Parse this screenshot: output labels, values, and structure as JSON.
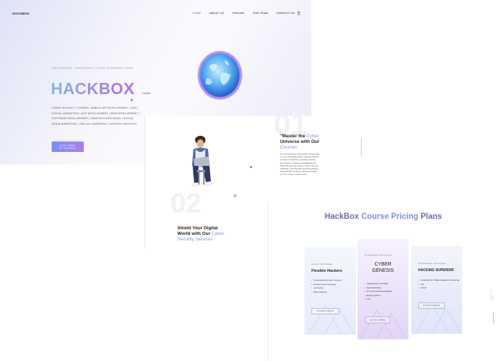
{
  "hero": {
    "brand": "HACKBOX",
    "nav": [
      "HOME",
      "ABOUT US",
      "PRICING",
      "OUR TEAM",
      "CONTACT US"
    ],
    "nav_active": "HOME",
    "tagline": "EMPOWERING TOMORROW'S CYBER WARRIORS TODAY",
    "title": "HACKBOX",
    "contact_label": "Contact",
    "services": "CYBER SECURITY COURSE | MOBILE APP DEVELOPMENT | SEO | DIGITAL MARKETING | APP DEVELOPMENT | WEB DEVELOPMENT | SOFTWARE DEVELOPMENT | GRAPHICS DESIGNING | SOCIAL MEDIA MARKETING | PAID AD CAMPAIGNS | HOSTING SERVICES",
    "cta_line1": "PLAY VIDEO",
    "cta_line2": "OF HACKBOX"
  },
  "about": {
    "number_1": "01",
    "number_2": "02",
    "master_pre": "\"Master the ",
    "master_hl1": "Cyber",
    "master_mid": " Universe with Our ",
    "master_hl2": "Courses",
    "description": "Our comprehensive cybersecurity courses take you from the fundamentals, covering essential concepts in networking, operating systems, and scripting, to advanced certifications like OSCP. We also offer hands-on labs, CTF-style challenges, and real-world pentesting practice that build skills employers value and prepare you for a career in cybersecurity.",
    "shield_pre": "Shield Your Digital World with Our ",
    "shield_hl": "Cyber Security Services"
  },
  "pricing": {
    "heading_1": "HackBox",
    "heading_2": "Course Pricing",
    "heading_3": "Plans",
    "side_text": "BACK TO TOP",
    "plans": [
      {
        "category": "BASIC PACKAGE",
        "name": "Flexible Hackers",
        "features": [
          "Understanding basic computer",
          "Programming Language",
          "Lab Setup",
          "Black Hacking"
        ],
        "button": "UNAVAILABLE"
      },
      {
        "category": "STANDARD PACKAGE",
        "name_line1": "CYBER",
        "name_line2": "GENESIS",
        "features": [
          "OPERATING SYSTEM",
          "NETWORKING",
          "PYTHON PROGRAMMING",
          "BASH SCRIPT",
          "CTF"
        ],
        "button": "CLICK HERE"
      },
      {
        "category": "STANDARD PACKAGE",
        "name": "HACKING SUPERIOR",
        "features": [
          "COMPLETE CYBER GENESIS COURSE",
          "OJT",
          "OSCP"
        ],
        "button": "UNAVAILABLE"
      }
    ]
  },
  "colors": {
    "accent_blue": "#7b8ff5",
    "accent_purple": "#a97ff3",
    "globe": "#4a9ff0"
  }
}
